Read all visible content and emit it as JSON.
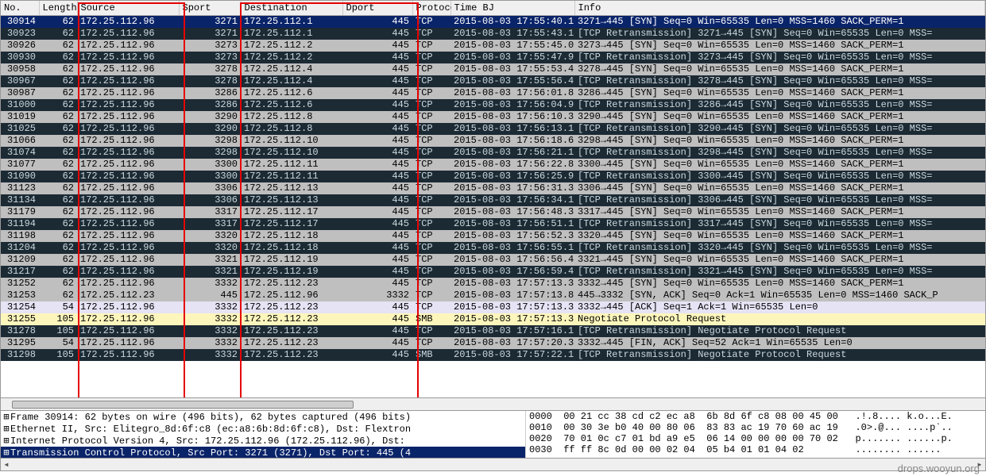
{
  "columns": {
    "no": "No.",
    "length": "Length",
    "source": "Source",
    "sport": "Sport",
    "destination": "Destination",
    "dport": "Dport",
    "protocol": "Protocol",
    "time_bj": "Time BJ",
    "info": "Info"
  },
  "packets": [
    {
      "style": "row-selected",
      "no": "30914",
      "len": "62",
      "src": "172.25.112.96",
      "sport": "3271",
      "dst": "172.25.112.1",
      "dport": "445",
      "proto": "TCP",
      "time": "2015-08-03 17:55:40.1",
      "info": "3271→445 [SYN] Seq=0 Win=65535 Len=0 MSS=1460 SACK_PERM=1",
      "info_cls": ""
    },
    {
      "style": "row-dark",
      "no": "30923",
      "len": "62",
      "src": "172.25.112.96",
      "sport": "3271",
      "dst": "172.25.112.1",
      "dport": "445",
      "proto": "TCP",
      "time": "2015-08-03 17:55:43.1",
      "info": "[TCP Retransmission] 3271→445 [SYN] Seq=0 Win=65535 Len=0 MSS=",
      "info_cls": "txt-info-orange"
    },
    {
      "style": "row-gray",
      "no": "30926",
      "len": "62",
      "src": "172.25.112.96",
      "sport": "3273",
      "dst": "172.25.112.2",
      "dport": "445",
      "proto": "TCP",
      "time": "2015-08-03 17:55:45.0",
      "info": "3273→445 [SYN] Seq=0 Win=65535 Len=0 MSS=1460 SACK_PERM=1",
      "info_cls": ""
    },
    {
      "style": "row-dark",
      "no": "30930",
      "len": "62",
      "src": "172.25.112.96",
      "sport": "3273",
      "dst": "172.25.112.2",
      "dport": "445",
      "proto": "TCP",
      "time": "2015-08-03 17:55:47.9",
      "info": "[TCP Retransmission] 3273→445 [SYN] Seq=0 Win=65535 Len=0 MSS=",
      "info_cls": "txt-info-orange"
    },
    {
      "style": "row-gray",
      "no": "30958",
      "len": "62",
      "src": "172.25.112.96",
      "sport": "3278",
      "dst": "172.25.112.4",
      "dport": "445",
      "proto": "TCP",
      "time": "2015-08-03 17:55:53.4",
      "info": "3278→445 [SYN] Seq=0 Win=65535 Len=0 MSS=1460 SACK_PERM=1",
      "info_cls": ""
    },
    {
      "style": "row-dark",
      "no": "30967",
      "len": "62",
      "src": "172.25.112.96",
      "sport": "3278",
      "dst": "172.25.112.4",
      "dport": "445",
      "proto": "TCP",
      "time": "2015-08-03 17:55:56.4",
      "info": "[TCP Retransmission] 3278→445 [SYN] Seq=0 Win=65535 Len=0 MSS=",
      "info_cls": "txt-info-orange"
    },
    {
      "style": "row-gray",
      "no": "30987",
      "len": "62",
      "src": "172.25.112.96",
      "sport": "3286",
      "dst": "172.25.112.6",
      "dport": "445",
      "proto": "TCP",
      "time": "2015-08-03 17:56:01.8",
      "info": "3286→445 [SYN] Seq=0 Win=65535 Len=0 MSS=1460 SACK_PERM=1",
      "info_cls": ""
    },
    {
      "style": "row-dark",
      "no": "31000",
      "len": "62",
      "src": "172.25.112.96",
      "sport": "3286",
      "dst": "172.25.112.6",
      "dport": "445",
      "proto": "TCP",
      "time": "2015-08-03 17:56:04.9",
      "info": "[TCP Retransmission] 3286→445 [SYN] Seq=0 Win=65535 Len=0 MSS=",
      "info_cls": "txt-info-orange"
    },
    {
      "style": "row-gray",
      "no": "31019",
      "len": "62",
      "src": "172.25.112.96",
      "sport": "3290",
      "dst": "172.25.112.8",
      "dport": "445",
      "proto": "TCP",
      "time": "2015-08-03 17:56:10.3",
      "info": "3290→445 [SYN] Seq=0 Win=65535 Len=0 MSS=1460 SACK_PERM=1",
      "info_cls": ""
    },
    {
      "style": "row-dark",
      "no": "31025",
      "len": "62",
      "src": "172.25.112.96",
      "sport": "3290",
      "dst": "172.25.112.8",
      "dport": "445",
      "proto": "TCP",
      "time": "2015-08-03 17:56:13.1",
      "info": "[TCP Retransmission] 3290→445 [SYN] Seq=0 Win=65535 Len=0 MSS=",
      "info_cls": "txt-info-orange"
    },
    {
      "style": "row-gray",
      "no": "31066",
      "len": "62",
      "src": "172.25.112.96",
      "sport": "3298",
      "dst": "172.25.112.10",
      "dport": "445",
      "proto": "TCP",
      "time": "2015-08-03 17:56:18.6",
      "info": "3298→445 [SYN] Seq=0 Win=65535 Len=0 MSS=1460 SACK_PERM=1",
      "info_cls": ""
    },
    {
      "style": "row-dark",
      "no": "31074",
      "len": "62",
      "src": "172.25.112.96",
      "sport": "3298",
      "dst": "172.25.112.10",
      "dport": "445",
      "proto": "TCP",
      "time": "2015-08-03 17:56:21.1",
      "info": "[TCP Retransmission] 3298→445 [SYN] Seq=0 Win=65535 Len=0 MSS=",
      "info_cls": "txt-info-orange"
    },
    {
      "style": "row-gray",
      "no": "31077",
      "len": "62",
      "src": "172.25.112.96",
      "sport": "3300",
      "dst": "172.25.112.11",
      "dport": "445",
      "proto": "TCP",
      "time": "2015-08-03 17:56:22.8",
      "info": "3300→445 [SYN] Seq=0 Win=65535 Len=0 MSS=1460 SACK_PERM=1",
      "info_cls": ""
    },
    {
      "style": "row-dark",
      "no": "31090",
      "len": "62",
      "src": "172.25.112.96",
      "sport": "3300",
      "dst": "172.25.112.11",
      "dport": "445",
      "proto": "TCP",
      "time": "2015-08-03 17:56:25.9",
      "info": "[TCP Retransmission] 3300→445 [SYN] Seq=0 Win=65535 Len=0 MSS=",
      "info_cls": "txt-info-orange"
    },
    {
      "style": "row-gray",
      "no": "31123",
      "len": "62",
      "src": "172.25.112.96",
      "sport": "3306",
      "dst": "172.25.112.13",
      "dport": "445",
      "proto": "TCP",
      "time": "2015-08-03 17:56:31.3",
      "info": "3306→445 [SYN] Seq=0 Win=65535 Len=0 MSS=1460 SACK_PERM=1",
      "info_cls": ""
    },
    {
      "style": "row-dark",
      "no": "31134",
      "len": "62",
      "src": "172.25.112.96",
      "sport": "3306",
      "dst": "172.25.112.13",
      "dport": "445",
      "proto": "TCP",
      "time": "2015-08-03 17:56:34.1",
      "info": "[TCP Retransmission] 3306→445 [SYN] Seq=0 Win=65535 Len=0 MSS=",
      "info_cls": "txt-info-orange"
    },
    {
      "style": "row-gray",
      "no": "31179",
      "len": "62",
      "src": "172.25.112.96",
      "sport": "3317",
      "dst": "172.25.112.17",
      "dport": "445",
      "proto": "TCP",
      "time": "2015-08-03 17:56:48.3",
      "info": "3317→445 [SYN] Seq=0 Win=65535 Len=0 MSS=1460 SACK_PERM=1",
      "info_cls": ""
    },
    {
      "style": "row-dark",
      "no": "31194",
      "len": "62",
      "src": "172.25.112.96",
      "sport": "3317",
      "dst": "172.25.112.17",
      "dport": "445",
      "proto": "TCP",
      "time": "2015-08-03 17:56:51.1",
      "info": "[TCP Retransmission] 3317→445 [SYN] Seq=0 Win=65535 Len=0 MSS=",
      "info_cls": "txt-info-orange"
    },
    {
      "style": "row-gray",
      "no": "31198",
      "len": "62",
      "src": "172.25.112.96",
      "sport": "3320",
      "dst": "172.25.112.18",
      "dport": "445",
      "proto": "TCP",
      "time": "2015-08-03 17:56:52.3",
      "info": "3320→445 [SYN] Seq=0 Win=65535 Len=0 MSS=1460 SACK_PERM=1",
      "info_cls": ""
    },
    {
      "style": "row-dark",
      "no": "31204",
      "len": "62",
      "src": "172.25.112.96",
      "sport": "3320",
      "dst": "172.25.112.18",
      "dport": "445",
      "proto": "TCP",
      "time": "2015-08-03 17:56:55.1",
      "info": "[TCP Retransmission] 3320→445 [SYN] Seq=0 Win=65535 Len=0 MSS=",
      "info_cls": "txt-info-orange"
    },
    {
      "style": "row-gray",
      "no": "31209",
      "len": "62",
      "src": "172.25.112.96",
      "sport": "3321",
      "dst": "172.25.112.19",
      "dport": "445",
      "proto": "TCP",
      "time": "2015-08-03 17:56:56.4",
      "info": "3321→445 [SYN] Seq=0 Win=65535 Len=0 MSS=1460 SACK_PERM=1",
      "info_cls": ""
    },
    {
      "style": "row-dark",
      "no": "31217",
      "len": "62",
      "src": "172.25.112.96",
      "sport": "3321",
      "dst": "172.25.112.19",
      "dport": "445",
      "proto": "TCP",
      "time": "2015-08-03 17:56:59.4",
      "info": "[TCP Retransmission] 3321→445 [SYN] Seq=0 Win=65535 Len=0 MSS=",
      "info_cls": "txt-info-orange"
    },
    {
      "style": "row-gray",
      "no": "31252",
      "len": "62",
      "src": "172.25.112.96",
      "sport": "3332",
      "dst": "172.25.112.23",
      "dport": "445",
      "proto": "TCP",
      "time": "2015-08-03 17:57:13.3",
      "info": "3332→445 [SYN] Seq=0 Win=65535 Len=0 MSS=1460 SACK_PERM=1",
      "info_cls": ""
    },
    {
      "style": "row-gray",
      "no": "31253",
      "len": "62",
      "src": "172.25.112.23",
      "sport": "445",
      "dst": "172.25.112.96",
      "dport": "3332",
      "proto": "TCP",
      "time": "2015-08-03 17:57:13.8",
      "info": "445→3332 [SYN, ACK] Seq=0 Ack=1 Win=65535 Len=0 MSS=1460 SACK_P",
      "info_cls": ""
    },
    {
      "style": "row-lav",
      "no": "31254",
      "len": "54",
      "src": "172.25.112.96",
      "sport": "3332",
      "dst": "172.25.112.23",
      "dport": "445",
      "proto": "TCP",
      "time": "2015-08-03 17:57:13.3",
      "info": "3332→445 [ACK] Seq=1 Ack=1 Win=65535 Len=0",
      "info_cls": ""
    },
    {
      "style": "row-yel",
      "no": "31255",
      "len": "105",
      "src": "172.25.112.96",
      "sport": "3332",
      "dst": "172.25.112.23",
      "dport": "445",
      "proto": "SMB",
      "time": "2015-08-03 17:57:13.3",
      "info": "Negotiate Protocol Request",
      "info_cls": ""
    },
    {
      "style": "row-dark",
      "no": "31278",
      "len": "105",
      "src": "172.25.112.96",
      "sport": "3332",
      "dst": "172.25.112.23",
      "dport": "445",
      "proto": "TCP",
      "time": "2015-08-03 17:57:16.1",
      "info": "[TCP Retransmission] Negotiate Protocol Request",
      "info_cls": "txt-info-orange"
    },
    {
      "style": "row-gray",
      "no": "31295",
      "len": "54",
      "src": "172.25.112.96",
      "sport": "3332",
      "dst": "172.25.112.23",
      "dport": "445",
      "proto": "TCP",
      "time": "2015-08-03 17:57:20.3",
      "info": "3332→445 [FIN, ACK] Seq=52 Ack=1 Win=65535 Len=0",
      "info_cls": ""
    },
    {
      "style": "row-dark",
      "no": "31298",
      "len": "105",
      "src": "172.25.112.96",
      "sport": "3332",
      "dst": "172.25.112.23",
      "dport": "445",
      "proto": "SMB",
      "time": "2015-08-03 17:57:22.1",
      "info": "[TCP Retransmission] Negotiate Protocol Request",
      "info_cls": "txt-info-orange"
    }
  ],
  "tree": {
    "frame": "Frame 30914: 62 bytes on wire (496 bits), 62 bytes captured (496 bits)",
    "eth": "Ethernet II, Src: Elitegro_8d:6f:c8 (ec:a8:6b:8d:6f:c8), Dst: Flextron",
    "ip": "Internet Protocol Version 4, Src: 172.25.112.96 (172.25.112.96), Dst:",
    "tcp": "Transmission Control Protocol, Src Port: 3271 (3271), Dst Port: 445 (4"
  },
  "hex": [
    "0000  00 21 cc 38 cd c2 ec a8  6b 8d 6f c8 08 00 45 00   .!.8.... k.o...E.",
    "0010  00 30 3e b0 40 00 80 06  83 83 ac 19 70 60 ac 19   .0>.@... ....p`..",
    "0020  70 01 0c c7 01 bd a9 e5  06 14 00 00 00 00 70 02   p....... ......p.",
    "0030  ff ff 8c 0d 00 00 02 04  05 b4 01 01 04 02         ........ ......"
  ],
  "watermark": "drops.wooyun.org"
}
